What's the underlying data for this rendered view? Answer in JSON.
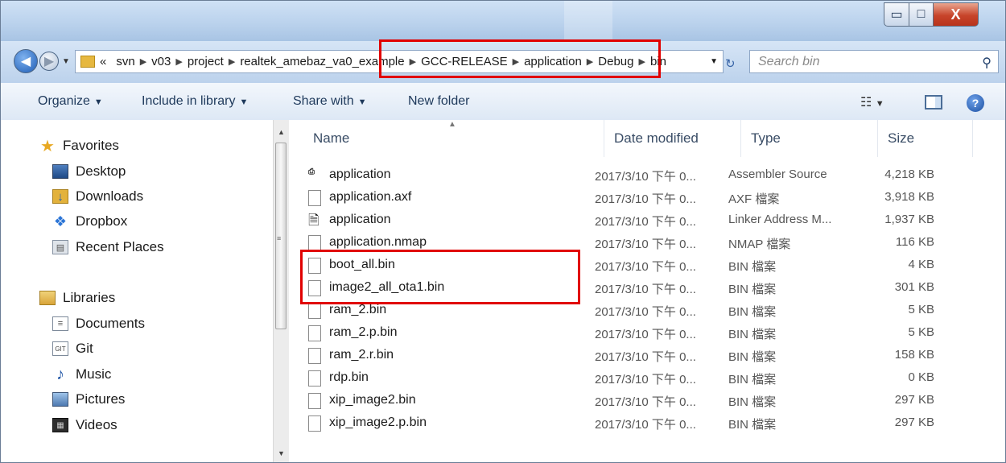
{
  "window": {
    "controls": {
      "minimize": "▭",
      "maximize": "□",
      "close": "X"
    }
  },
  "address": {
    "prefix": "«",
    "crumbs": [
      "svn",
      "v03",
      "project",
      "realtek_amebaz_va0_example",
      "GCC-RELEASE",
      "application",
      "Debug",
      "bin"
    ],
    "search_placeholder": "Search bin"
  },
  "toolbar": {
    "organize": "Organize",
    "include": "Include in library",
    "share": "Share with",
    "new_folder": "New folder"
  },
  "nav": {
    "favorites_header": "Favorites",
    "favorites": [
      "Desktop",
      "Downloads",
      "Dropbox",
      "Recent Places"
    ],
    "libraries_header": "Libraries",
    "libraries": [
      "Documents",
      "Git",
      "Music",
      "Pictures",
      "Videos"
    ]
  },
  "columns": {
    "name": "Name",
    "date": "Date modified",
    "type": "Type",
    "size": "Size"
  },
  "files": [
    {
      "name": "application",
      "date": "2017/3/10 下午 0...",
      "type": "Assembler Source",
      "size": "4,218 KB",
      "icon": "asm-file-icon"
    },
    {
      "name": "application.axf",
      "date": "2017/3/10 下午 0...",
      "type": "AXF 檔案",
      "size": "3,918 KB",
      "icon": "file-icon"
    },
    {
      "name": "application",
      "date": "2017/3/10 下午 0...",
      "type": "Linker Address M...",
      "size": "1,937 KB",
      "icon": "linker-file-icon"
    },
    {
      "name": "application.nmap",
      "date": "2017/3/10 下午 0...",
      "type": "NMAP 檔案",
      "size": "116 KB",
      "icon": "file-icon"
    },
    {
      "name": "boot_all.bin",
      "date": "2017/3/10 下午 0...",
      "type": "BIN 檔案",
      "size": "4 KB",
      "icon": "file-icon"
    },
    {
      "name": "image2_all_ota1.bin",
      "date": "2017/3/10 下午 0...",
      "type": "BIN 檔案",
      "size": "301 KB",
      "icon": "file-icon"
    },
    {
      "name": "ram_2.bin",
      "date": "2017/3/10 下午 0...",
      "type": "BIN 檔案",
      "size": "5 KB",
      "icon": "file-icon"
    },
    {
      "name": "ram_2.p.bin",
      "date": "2017/3/10 下午 0...",
      "type": "BIN 檔案",
      "size": "5 KB",
      "icon": "file-icon"
    },
    {
      "name": "ram_2.r.bin",
      "date": "2017/3/10 下午 0...",
      "type": "BIN 檔案",
      "size": "158 KB",
      "icon": "file-icon"
    },
    {
      "name": "rdp.bin",
      "date": "2017/3/10 下午 0...",
      "type": "BIN 檔案",
      "size": "0 KB",
      "icon": "file-icon"
    },
    {
      "name": "xip_image2.bin",
      "date": "2017/3/10 下午 0...",
      "type": "BIN 檔案",
      "size": "297 KB",
      "icon": "file-icon"
    },
    {
      "name": "xip_image2.p.bin",
      "date": "2017/3/10 下午 0...",
      "type": "BIN 檔案",
      "size": "297 KB",
      "icon": "file-icon"
    }
  ],
  "highlight_color": "#e10000"
}
